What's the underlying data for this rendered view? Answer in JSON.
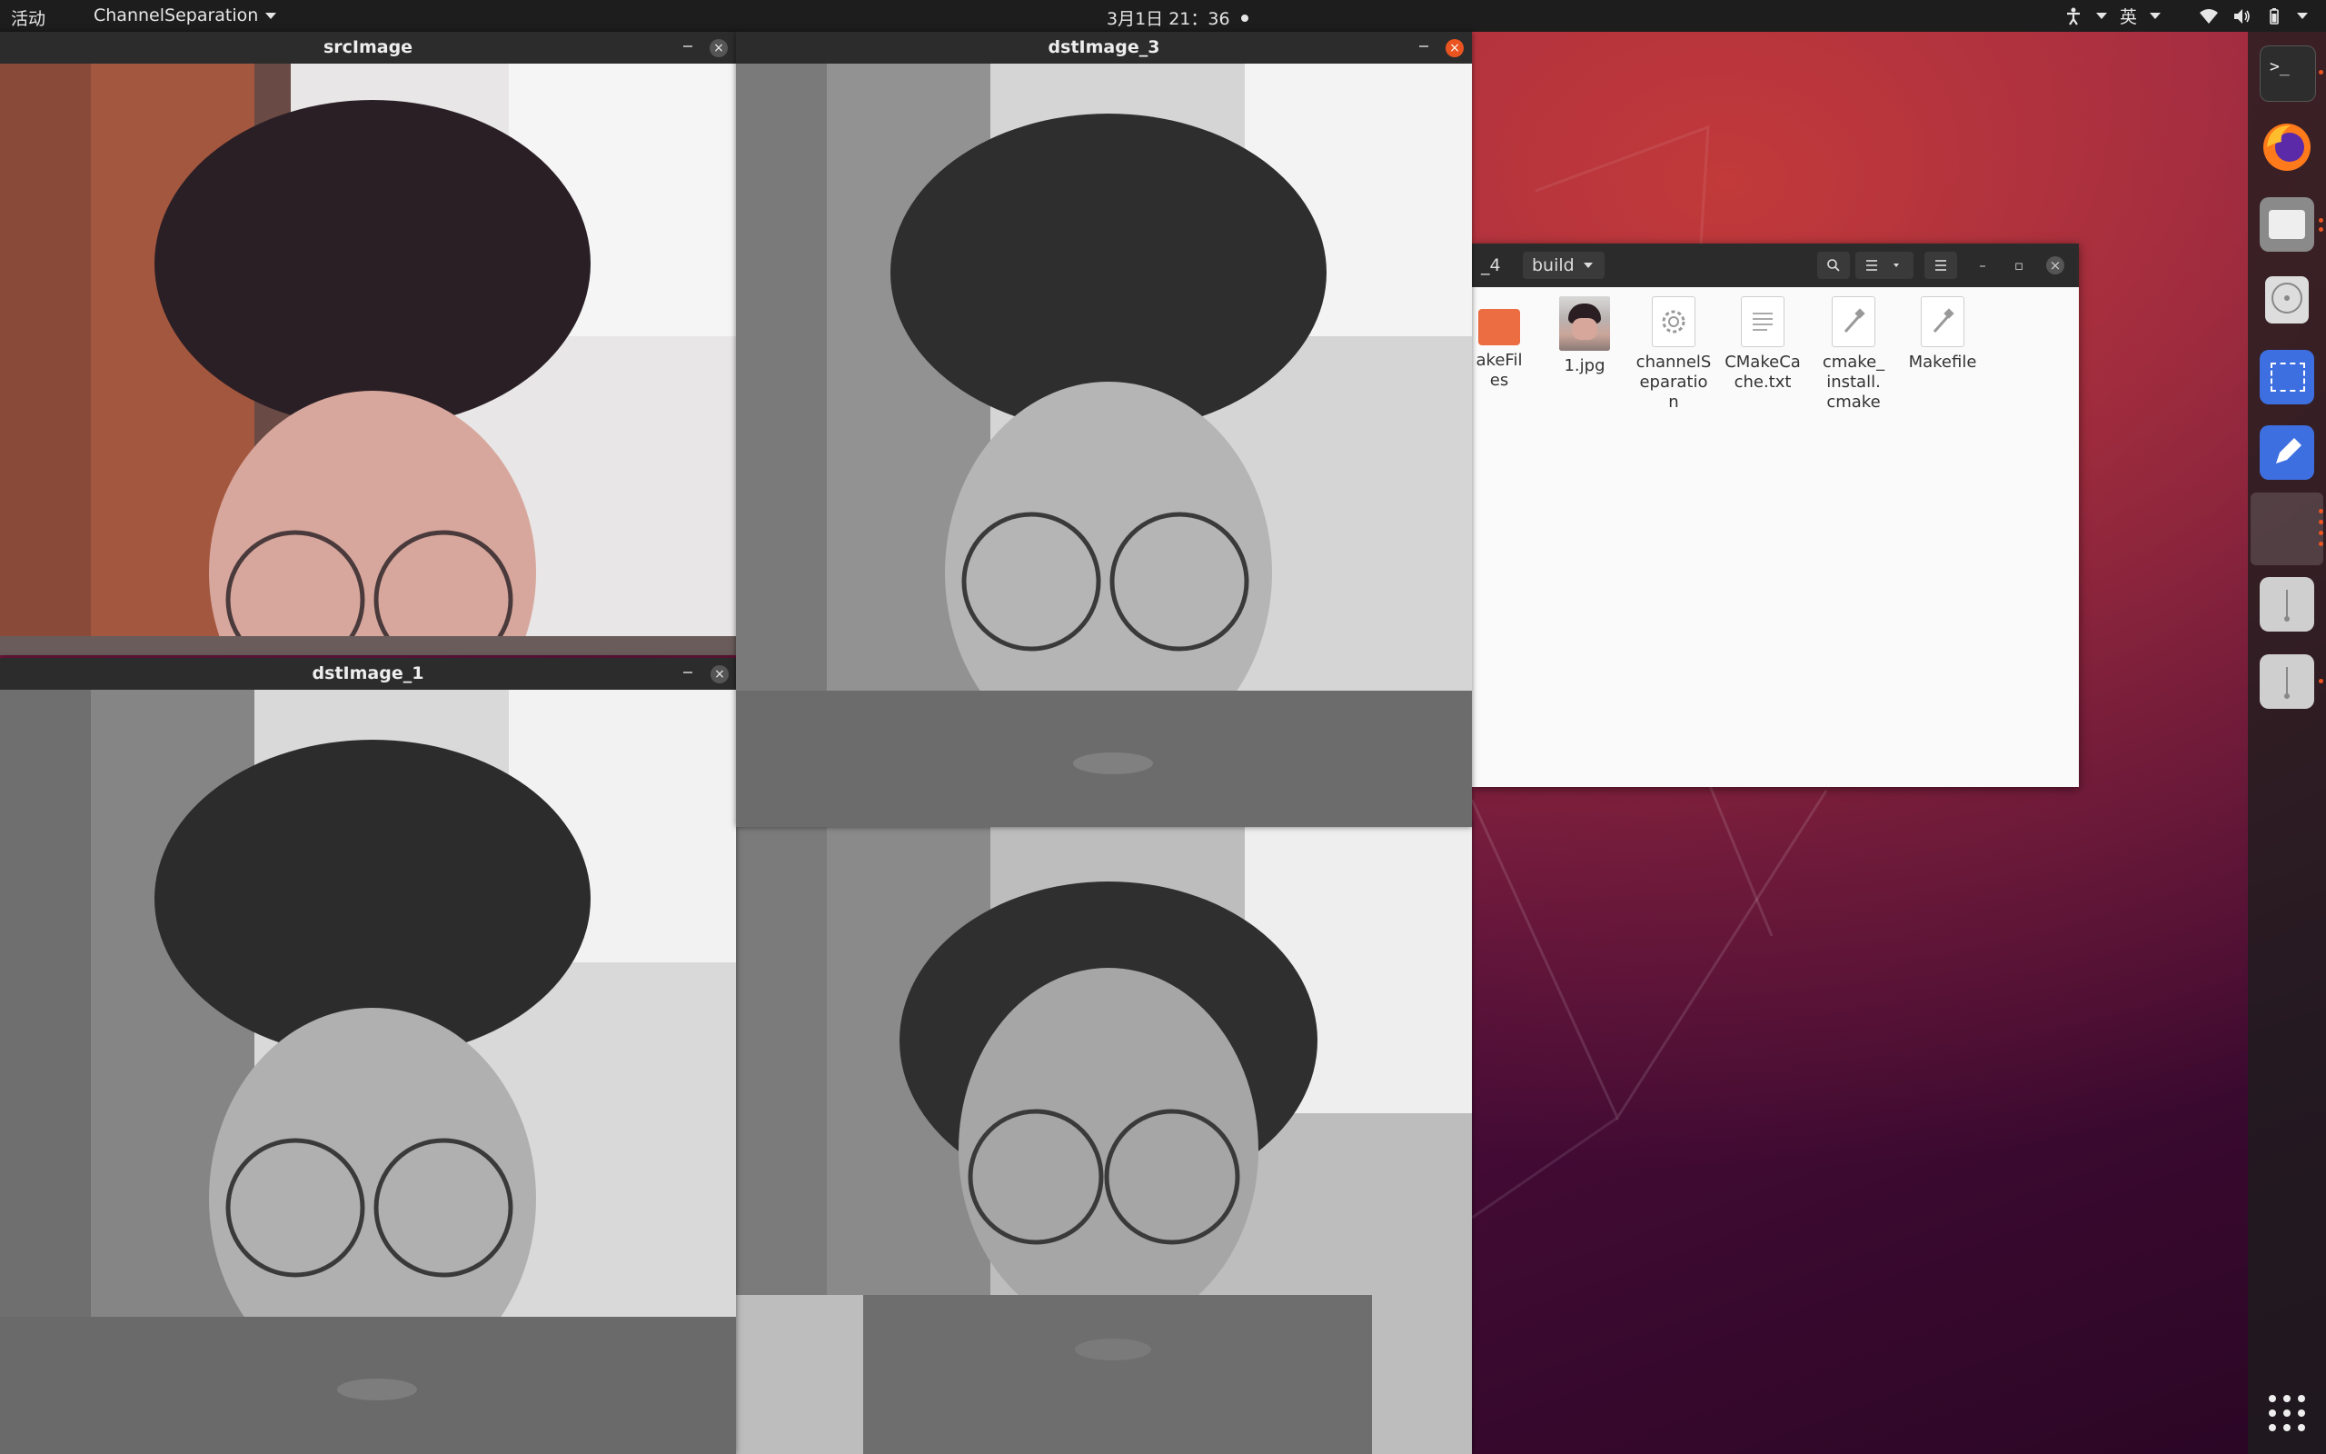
{
  "topbar": {
    "activities": "活动",
    "app_menu": "ChannelSeparation",
    "clock": "3月1日 21：36",
    "input_method": "英"
  },
  "windows": {
    "src": {
      "title": "srcImage"
    },
    "dst1": {
      "title": "dstImage_1"
    },
    "dst3": {
      "title": "dstImage_3"
    }
  },
  "files": {
    "breadcrumb_prev": "_4",
    "breadcrumb_current": "build",
    "items": [
      {
        "label": "akeFil\nes",
        "icon": "folder-icon"
      },
      {
        "label": "1.jpg",
        "icon": "image-thumbnail"
      },
      {
        "label": "channelS\neparatio\nn",
        "icon": "executable-icon"
      },
      {
        "label": "CMakeCa\nche.txt",
        "icon": "text-file-icon"
      },
      {
        "label": "cmake_\ninstall.\ncmake",
        "icon": "script-icon"
      },
      {
        "label": "Makefile",
        "icon": "script-icon"
      }
    ]
  },
  "dock": {
    "apps": [
      "terminal-icon",
      "firefox-icon",
      "files-icon",
      "disc-icon",
      "screenshot-icon",
      "text-editor-icon",
      "opencv-window-icon",
      "usb-drive-icon",
      "usb-drive-icon",
      "show-apps-icon"
    ]
  },
  "colors": {
    "accent": "#e95420",
    "topbar": "#1d1d1d",
    "window_title": "#2c2c2c"
  }
}
